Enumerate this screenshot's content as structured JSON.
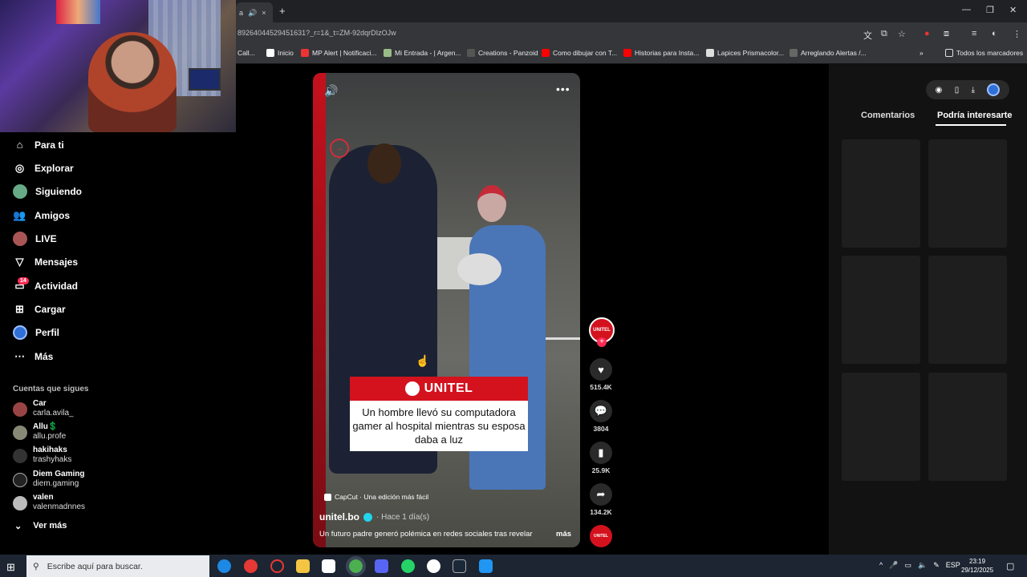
{
  "browser": {
    "tab_close": "×",
    "new_tab": "+",
    "url": "89264044529451631?_r=1&_t=ZM-92dqrDIzOJw",
    "bookmarks": [
      "Call...",
      "Inicio",
      "MP Alert | Notificaci...",
      "Mi Entrada - | Argen...",
      "Creations - Panzoid",
      "Como dibujar con T...",
      "Historias para Insta...",
      "Lapices Prismacolor...",
      "Arreglando Alertas /..."
    ],
    "bookmarks_overflow": "»",
    "all_bookmarks": "Todos los marcadores",
    "window_controls": [
      "—",
      "❐",
      "✕"
    ]
  },
  "sidebar": {
    "nav": [
      {
        "label": "Para ti",
        "icon": "home-icon"
      },
      {
        "label": "Explorar",
        "icon": "compass-icon"
      },
      {
        "label": "Siguiendo",
        "icon": "following-avatar"
      },
      {
        "label": "Amigos",
        "icon": "friends-icon"
      },
      {
        "label": "LIVE",
        "icon": "live-avatar"
      },
      {
        "label": "Mensajes",
        "icon": "send-icon"
      },
      {
        "label": "Actividad",
        "icon": "inbox-icon"
      },
      {
        "label": "Cargar",
        "icon": "upload-icon"
      },
      {
        "label": "Perfil",
        "icon": "profile-avatar"
      },
      {
        "label": "Más",
        "icon": "more-icon"
      }
    ],
    "activity_badge": "14",
    "following_heading": "Cuentas que sigues",
    "accounts": [
      {
        "name": "Car",
        "handle": "carla.avila_"
      },
      {
        "name": "Allu💲",
        "handle": "allu.profe"
      },
      {
        "name": "hakihaks",
        "handle": "trashyhaks"
      },
      {
        "name": "Diem Gaming",
        "handle": "diem.gaming"
      },
      {
        "name": "valen",
        "handle": "valenmadnnes"
      }
    ],
    "see_more": "Ver más"
  },
  "video": {
    "caption_brand": "UNITEL",
    "caption_text": "Un hombre llevó su computadora gamer al hospital mientras su esposa daba a luz",
    "capcut": "CapCut · Una edición más fácil",
    "author": "unitel.bo",
    "time_ago": "· Hace 1 día(s)",
    "description": "Un futuro padre generó polémica en redes sociales tras revelar",
    "description_more": "más",
    "avatar_text": "UNITEL"
  },
  "actions": {
    "likes": "515.4K",
    "comments": "3804",
    "saves": "25.9K",
    "shares": "134.2K"
  },
  "right_panel": {
    "tab_comments": "Comentarios",
    "tab_interest": "Podría interesarte"
  },
  "taskbar": {
    "search_placeholder": "Escribe aquí para buscar.",
    "lang": "ESP",
    "time": "23:19",
    "date": "29/12/2025"
  },
  "colors": {
    "accent": "#fe2c55",
    "unitel_red": "#d3121e",
    "taskbar": "#1c2531"
  }
}
